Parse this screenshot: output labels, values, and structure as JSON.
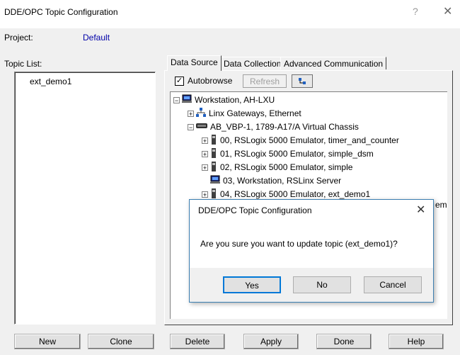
{
  "window": {
    "title": "DDE/OPC Topic Configuration",
    "help_glyph": "?",
    "close_glyph": "✕"
  },
  "project": {
    "label": "Project:",
    "value": "Default"
  },
  "topic_list": {
    "label": "Topic List:",
    "items": [
      "ext_demo1"
    ]
  },
  "tabs": [
    "Data Source",
    "Data Collection",
    "Advanced Communication"
  ],
  "data_source": {
    "autobrowse_label": "Autobrowse",
    "autobrowse_checked": true,
    "refresh_label": "Refresh",
    "tree": [
      {
        "label": "Workstation, AH-LXU",
        "icon": "workstation-icon",
        "expander": "−"
      },
      {
        "label": "Linx Gateways, Ethernet",
        "icon": "network-icon",
        "expander": "+"
      },
      {
        "label": "AB_VBP-1, 1789-A17/A Virtual Chassis",
        "icon": "chassis-icon",
        "expander": "−"
      },
      {
        "label": "00, RSLogix 5000 Emulator, timer_and_counter",
        "icon": "module-icon",
        "expander": "+"
      },
      {
        "label": "01, RSLogix 5000 Emulator, simple_dsm",
        "icon": "module-icon",
        "expander": "+"
      },
      {
        "label": "02, RSLogix 5000 Emulator, simple",
        "icon": "module-icon",
        "expander": "+"
      },
      {
        "label": "03, Workstation, RSLinx Server",
        "icon": "workstation-icon",
        "expander": ""
      },
      {
        "label": "04, RSLogix 5000 Emulator, ext_demo1",
        "icon": "module-icon",
        "expander": "+"
      }
    ],
    "overflow_text": "em"
  },
  "buttons": {
    "new": "New",
    "clone": "Clone",
    "delete": "Delete",
    "apply": "Apply",
    "done": "Done",
    "help": "Help"
  },
  "dialog": {
    "title": "DDE/OPC Topic Configuration",
    "close_glyph": "✕",
    "message": "Are you sure you want to update topic (ext_demo1)?",
    "yes": "Yes",
    "no": "No",
    "cancel": "Cancel"
  }
}
